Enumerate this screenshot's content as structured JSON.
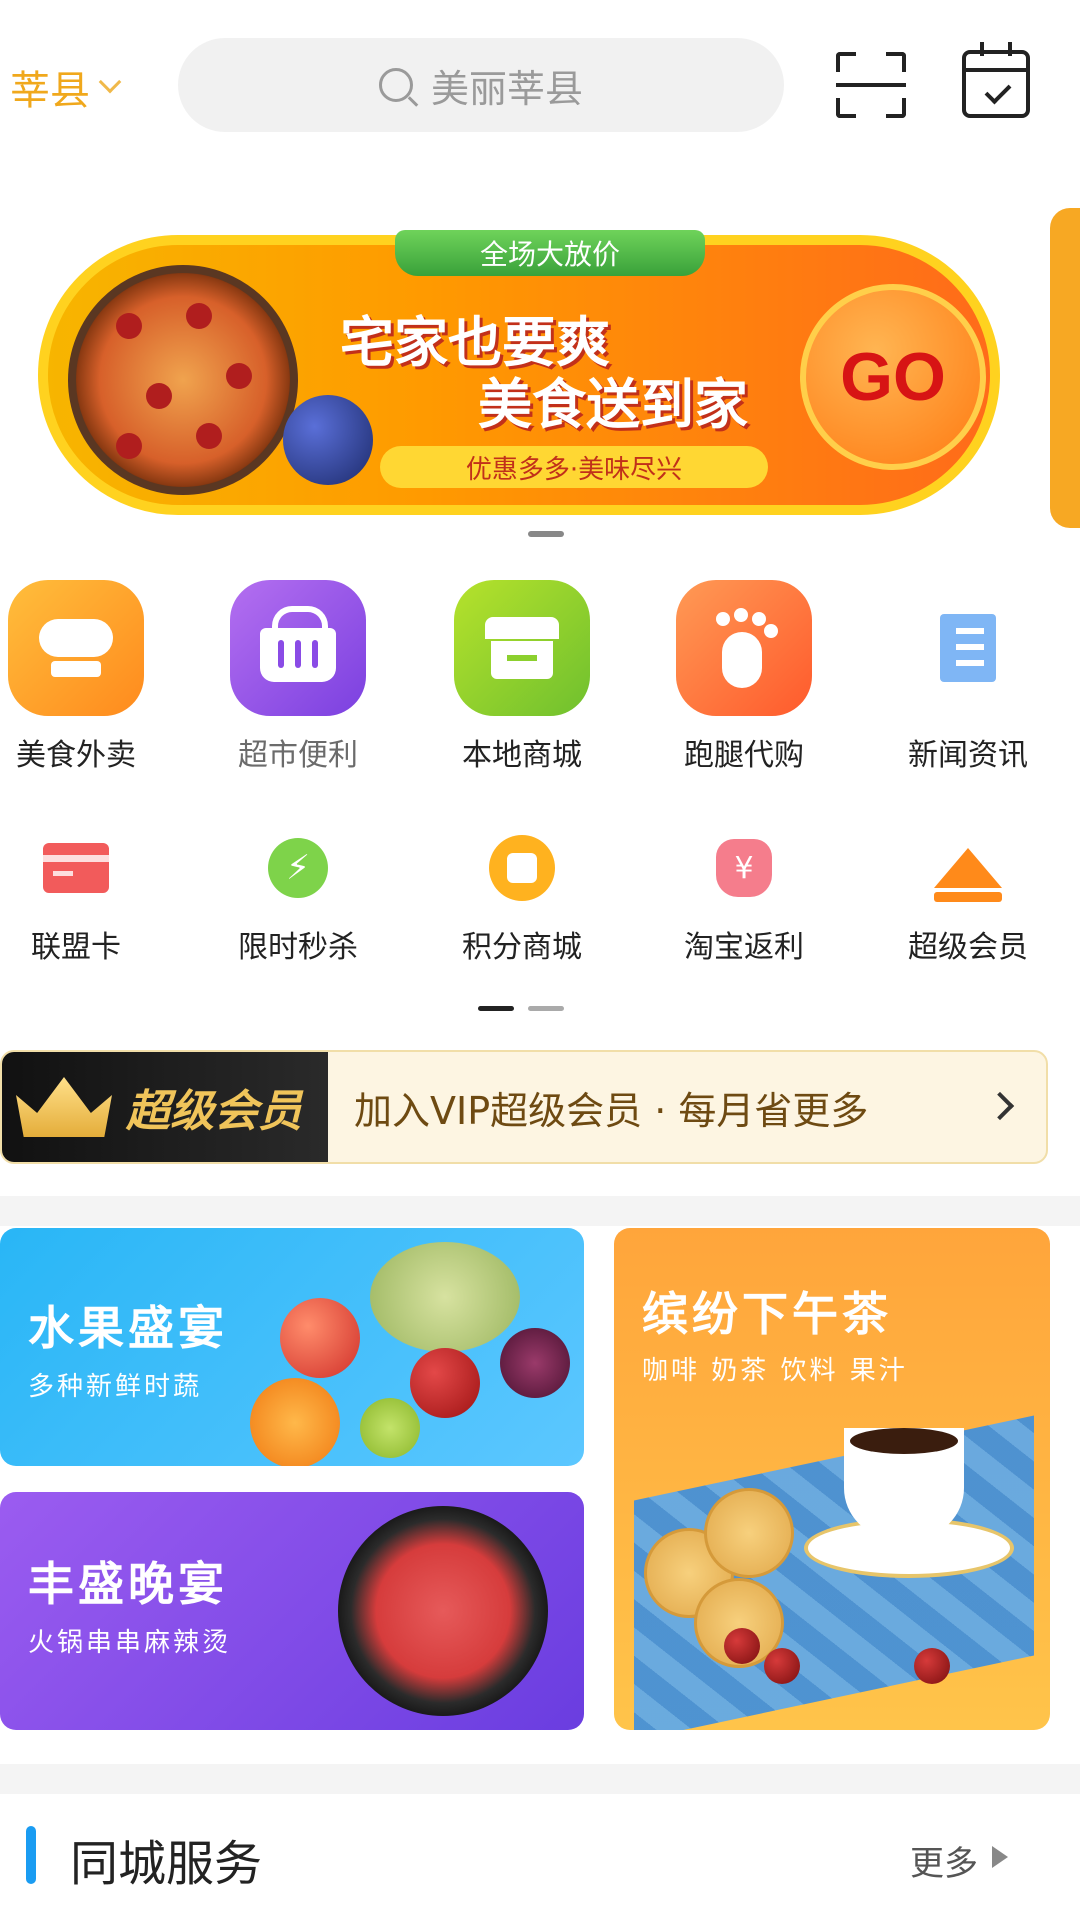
{
  "header": {
    "city": "莘县",
    "search_placeholder": "美丽莘县"
  },
  "banner": {
    "top_tag": "全场大放价",
    "line1": "宅家也要爽",
    "line2": "美食送到家",
    "sub": "优惠多多·美味尽兴",
    "go": "GO"
  },
  "grid": {
    "row1": [
      {
        "label": "美食外卖",
        "icon": "chef-hat-icon"
      },
      {
        "label": "超市便利",
        "icon": "basket-icon"
      },
      {
        "label": "本地商城",
        "icon": "store-icon"
      },
      {
        "label": "跑腿代购",
        "icon": "footprint-icon"
      },
      {
        "label": "新闻资讯",
        "icon": "news-icon"
      }
    ],
    "row2": [
      {
        "label": "联盟卡",
        "icon": "card-icon"
      },
      {
        "label": "限时秒杀",
        "icon": "alarm-clock-icon"
      },
      {
        "label": "积分商城",
        "icon": "coin-icon"
      },
      {
        "label": "淘宝返利",
        "icon": "money-bag-icon"
      },
      {
        "label": "超级会员",
        "icon": "crown-icon"
      }
    ],
    "page_indicator": {
      "pages": 2,
      "active": 0
    }
  },
  "vip": {
    "badge": "超级会员",
    "text": "加入VIP超级会员 · 每月省更多"
  },
  "promos": {
    "fruit": {
      "title": "水果盛宴",
      "sub": "多种新鲜时蔬"
    },
    "feast": {
      "title": "丰盛晚宴",
      "sub": "火锅串串麻辣烫"
    },
    "tea": {
      "title": "缤纷下午茶",
      "sub": "咖啡 奶茶 饮料 果汁"
    }
  },
  "section": {
    "title": "同城服务",
    "more": "更多"
  },
  "colors": {
    "city": "#f0a81c",
    "accent_blue": "#1a9cf2",
    "vip_text": "#6e4a12"
  }
}
